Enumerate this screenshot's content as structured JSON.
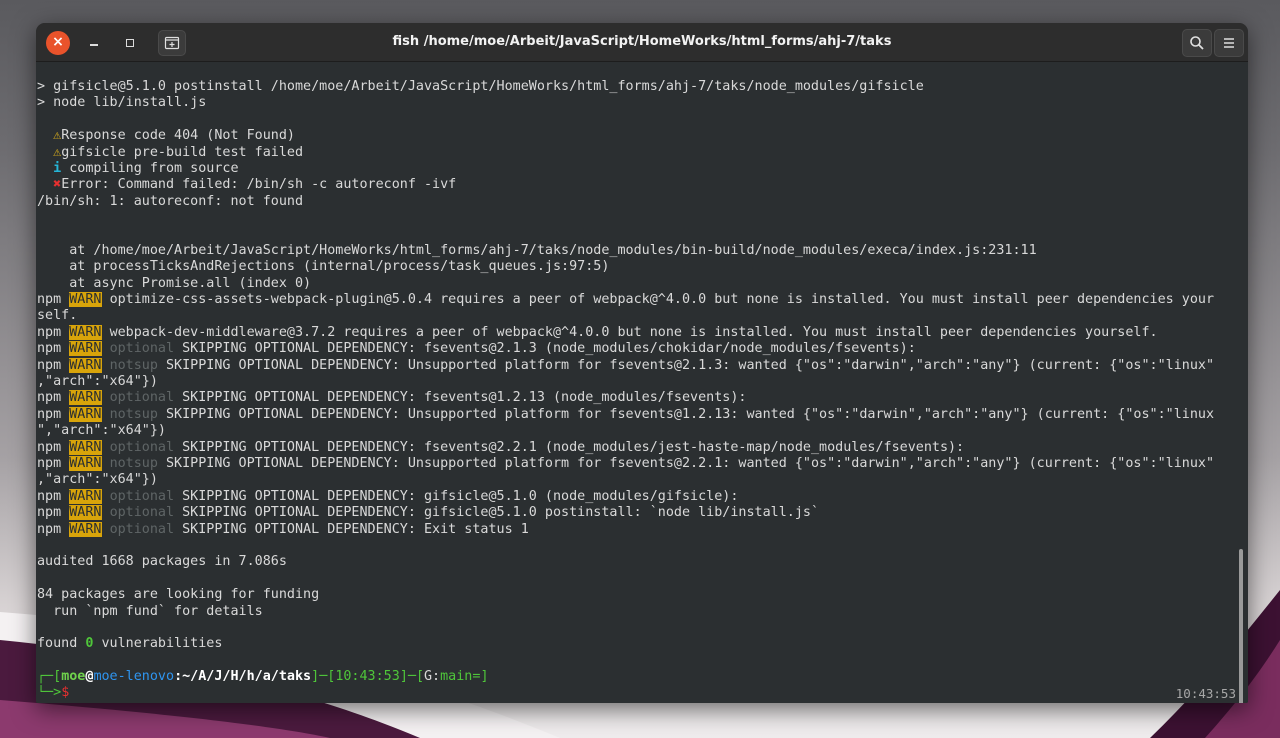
{
  "window": {
    "title": "fish /home/moe/Arbeit/JavaScript/HomeWorks/html_forms/ahj-7/taks",
    "close_glyph": "×"
  },
  "terminal": {
    "l01": "> gifsicle@5.1.0 postinstall /home/moe/Arbeit/JavaScript/HomeWorks/html_forms/ahj-7/taks/node_modules/gifsicle",
    "l02": "> node lib/install.js",
    "l04_icon": "⚠",
    "l04_text": "Response code 404 (Not Found)",
    "l05_icon": "⚠",
    "l05_text": "gifsicle pre-build test failed",
    "l06_icon": "i",
    "l06_text": "compiling from source",
    "l07_icon": "✖",
    "l07_text": "Error: Command failed: /bin/sh -c autoreconf -ivf",
    "l08": "/bin/sh: 1: autoreconf: not found",
    "l11": "    at /home/moe/Arbeit/JavaScript/HomeWorks/html_forms/ahj-7/taks/node_modules/bin-build/node_modules/execa/index.js:231:11",
    "l12": "    at processTicksAndRejections (internal/process/task_queues.js:97:5)",
    "l13": "    at async Promise.all (index 0)",
    "npm": "npm",
    "warn": "WARN",
    "optional": "optional",
    "notsup": "notsup",
    "l14": "optimize-css-assets-webpack-plugin@5.0.4 requires a peer of webpack@^4.0.0 but none is installed. You must install peer dependencies your",
    "l15": "self.",
    "l16": "webpack-dev-middleware@3.7.2 requires a peer of webpack@^4.0.0 but none is installed. You must install peer dependencies yourself.",
    "l17": "SKIPPING OPTIONAL DEPENDENCY: fsevents@2.1.3 (node_modules/chokidar/node_modules/fsevents):",
    "l18": "SKIPPING OPTIONAL DEPENDENCY: Unsupported platform for fsevents@2.1.3: wanted {\"os\":\"darwin\",\"arch\":\"any\"} (current: {\"os\":\"linux\"",
    "l19": ",\"arch\":\"x64\"})",
    "l20": "SKIPPING OPTIONAL DEPENDENCY: fsevents@1.2.13 (node_modules/fsevents):",
    "l21": "SKIPPING OPTIONAL DEPENDENCY: Unsupported platform for fsevents@1.2.13: wanted {\"os\":\"darwin\",\"arch\":\"any\"} (current: {\"os\":\"linux",
    "l22": "\",\"arch\":\"x64\"})",
    "l23": "SKIPPING OPTIONAL DEPENDENCY: fsevents@2.2.1 (node_modules/jest-haste-map/node_modules/fsevents):",
    "l24": "SKIPPING OPTIONAL DEPENDENCY: Unsupported platform for fsevents@2.2.1: wanted {\"os\":\"darwin\",\"arch\":\"any\"} (current: {\"os\":\"linux\"",
    "l25": ",\"arch\":\"x64\"})",
    "l26": "SKIPPING OPTIONAL DEPENDENCY: gifsicle@5.1.0 (node_modules/gifsicle):",
    "l27": "SKIPPING OPTIONAL DEPENDENCY: gifsicle@5.1.0 postinstall: `node lib/install.js`",
    "l28": "SKIPPING OPTIONAL DEPENDENCY: Exit status 1",
    "l30": "audited 1668 packages in 7.086s",
    "l32": "84 packages are looking for funding",
    "l33": "  run `npm fund` for details",
    "l35_a": "found ",
    "l35_b": "0",
    "l35_c": " vulnerabilities",
    "prompt": {
      "corner_top": "┌─",
      "bracket_open": "[",
      "user": "moe",
      "at": "@",
      "host": "moe-lenovo",
      "path": ":~/A/J/H/h/a/taks",
      "bracket_close": "]",
      "dash1": "─",
      "time_open": "[",
      "time": "10:43:53",
      "time_close": "]",
      "dash2": "─",
      "git_open": "[",
      "git_label": "G:",
      "git_branch": "main=",
      "git_close": "]",
      "corner_bottom": "└─>",
      "cursor": "$"
    },
    "right_clock": "10:43:53"
  }
}
